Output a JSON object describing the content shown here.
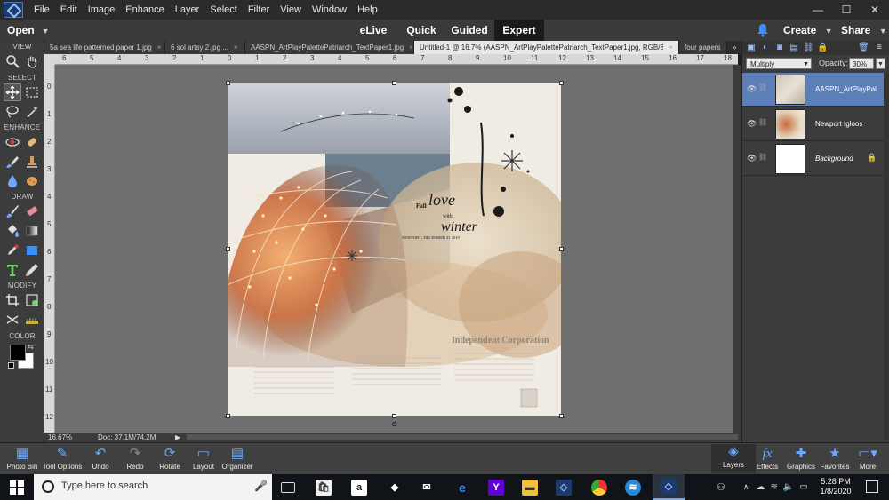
{
  "menubar": {
    "items": [
      "File",
      "Edit",
      "Image",
      "Enhance",
      "Layer",
      "Select",
      "Filter",
      "View",
      "Window",
      "Help"
    ],
    "window_controls": [
      "—",
      "☐",
      "✕"
    ]
  },
  "modebar": {
    "open_label": "Open",
    "tabs": [
      "eLive",
      "Quick",
      "Guided",
      "Expert"
    ],
    "active_tab": "Expert",
    "create_label": "Create",
    "share_label": "Share"
  },
  "tools": {
    "groups": [
      "VIEW",
      "SELECT",
      "ENHANCE",
      "DRAW",
      "MODIFY",
      "COLOR"
    ]
  },
  "doc_tabs": [
    {
      "title": "5a sea life patterned paper 1.jpg",
      "close": "×"
    },
    {
      "title": "6 sol artsy 2.jpg ...",
      "close": "×"
    },
    {
      "title": "AASPN_ArtPlayPalettePatriarch_TextPaper1.jpg",
      "close": "×"
    },
    {
      "title": "Untitled-1 @ 16.7% (AASPN_ArtPlayPalettePatriarch_TextPaper1.jpg, RGB/8) *",
      "close": "×",
      "active": true
    },
    {
      "title": "four papers",
      "close": ""
    }
  ],
  "tabs_more": "»",
  "ruler": {
    "h_labels": [
      "6",
      "5",
      "4",
      "3",
      "2",
      "1",
      "0",
      "1",
      "2",
      "3",
      "4",
      "5",
      "6",
      "7",
      "8",
      "9",
      "10",
      "11",
      "12",
      "13",
      "14",
      "15",
      "16",
      "17",
      "18"
    ],
    "v_labels": [
      "0",
      "1",
      "2",
      "3",
      "4",
      "5",
      "6",
      "7",
      "8",
      "9",
      "10",
      "11",
      "12"
    ]
  },
  "status": {
    "zoom": "16.67%",
    "doc_size": "Doc: 37.1M/74.2M"
  },
  "artwork": {
    "title_small": "Fall",
    "title_main": "love",
    "title_with": "with",
    "title_end": "winter",
    "date_line": "NEWPORT | DECEMBER 21 2019",
    "newspaper_head": "Independent Corporation"
  },
  "layers_panel": {
    "blend_mode": "Multiply",
    "opacity_label": "Opacity:",
    "opacity_value": "30%",
    "layers": [
      {
        "name": "AASPN_ArtPlayPal...",
        "selected": true
      },
      {
        "name": "Newport Igloos",
        "selected": false
      },
      {
        "name": "Background",
        "selected": false
      }
    ]
  },
  "bottom_left": [
    {
      "label": "Photo Bin",
      "icon": "photo-bin-icon"
    },
    {
      "label": "Tool Options",
      "icon": "tool-options-icon"
    },
    {
      "label": "Undo",
      "icon": "undo-icon"
    },
    {
      "label": "Redo",
      "icon": "redo-icon"
    },
    {
      "label": "Rotate",
      "icon": "rotate-icon"
    },
    {
      "label": "Layout",
      "icon": "layout-icon"
    },
    {
      "label": "Organizer",
      "icon": "organizer-icon"
    }
  ],
  "bottom_right": [
    {
      "label": "Layers",
      "icon": "layers-icon"
    },
    {
      "label": "Effects",
      "icon": "effects-icon"
    },
    {
      "label": "Graphics",
      "icon": "graphics-icon"
    },
    {
      "label": "Favorites",
      "icon": "favorites-icon"
    },
    {
      "label": "More",
      "icon": "more-icon"
    }
  ],
  "taskbar": {
    "search_placeholder": "Type here to search",
    "time": "5:28 PM",
    "date": "1/8/2020",
    "apps": [
      "task-view",
      "store",
      "amazon",
      "dropbox",
      "mail",
      "edge",
      "yahoo",
      "file-explorer",
      "elements-organizer",
      "chrome",
      "app-blue",
      "photoshop-elements"
    ]
  },
  "colors": {
    "accent": "#3d8eff",
    "layer_selected": "#5c7fb8",
    "canvas_bg": "#6f6f6f"
  }
}
